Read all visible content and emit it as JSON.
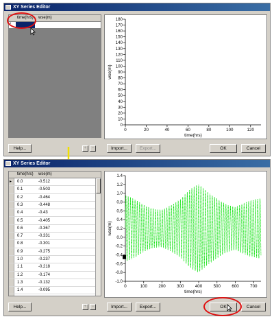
{
  "top": {
    "title": "XY Series Editor",
    "columns": [
      "time(hrs)",
      "wse(m)"
    ],
    "buttons": {
      "help": "Help...",
      "import": "Import...",
      "export": "Export...",
      "ok": "OK",
      "cancel": "Cancel"
    },
    "chart": {
      "ylabel": "wse(m)",
      "xlabel": "time(hrs)",
      "yticks": [
        "0",
        "10",
        "20",
        "30",
        "40",
        "50",
        "60",
        "70",
        "80",
        "90",
        "100",
        "110",
        "120",
        "130",
        "140",
        "150",
        "160",
        "170",
        "180"
      ],
      "xticks": [
        "0",
        "20",
        "40",
        "60",
        "80",
        "100",
        "120"
      ]
    }
  },
  "bottom": {
    "title": "XY Series Editor",
    "columns": [
      "time(hrs)",
      "wse(m)"
    ],
    "rows": [
      [
        "0.0",
        "-0.512"
      ],
      [
        "0.1",
        "-0.503"
      ],
      [
        "0.2",
        "-0.464"
      ],
      [
        "0.3",
        "-0.448"
      ],
      [
        "0.4",
        "-0.43"
      ],
      [
        "0.5",
        "-0.405"
      ],
      [
        "0.6",
        "-0.367"
      ],
      [
        "0.7",
        "-0.331"
      ],
      [
        "0.8",
        "-0.301"
      ],
      [
        "0.9",
        "-0.275"
      ],
      [
        "1.0",
        "-0.237"
      ],
      [
        "1.1",
        "-0.218"
      ],
      [
        "1.2",
        "-0.174"
      ],
      [
        "1.3",
        "-0.132"
      ],
      [
        "1.4",
        "-0.095"
      ]
    ],
    "buttons": {
      "help": "Help...",
      "import": "Import...",
      "export": "Export...",
      "ok": "OK",
      "cancel": "Cancel"
    },
    "chart": {
      "ylabel": "wse(m)",
      "xlabel": "time(hrs)",
      "yticks": [
        "-1.0",
        "-0.8",
        "-0.6",
        "-0.4",
        "-0.2",
        "0.0",
        "0.2",
        "0.4",
        "0.6",
        "0.8",
        "1.0",
        "1.2",
        "1.4"
      ],
      "xticks": [
        "0",
        "100",
        "200",
        "300",
        "400",
        "500",
        "600",
        "700"
      ]
    }
  },
  "chart_data": [
    {
      "type": "line",
      "x": [
        0,
        130
      ],
      "y": [
        0,
        180
      ],
      "series": [
        {
          "values": []
        }
      ],
      "xlabel": "time(hrs)",
      "ylabel": "wse(m)",
      "xlim": [
        0,
        130
      ],
      "ylim": [
        0,
        180
      ]
    },
    {
      "type": "line",
      "xlabel": "time(hrs)",
      "ylabel": "wse(m)",
      "xlim": [
        0,
        740
      ],
      "ylim": [
        -1.0,
        1.4
      ],
      "series": [
        {
          "color": "#00e000",
          "amplitude_envelope": [
            [
              0,
              0.75
            ],
            [
              100,
              0.65
            ],
            [
              200,
              0.6
            ],
            [
              300,
              0.7
            ],
            [
              400,
              1.05
            ],
            [
              500,
              0.95
            ],
            [
              600,
              0.6
            ],
            [
              700,
              0.65
            ],
            [
              740,
              0.7
            ]
          ],
          "mean": 0.2
        }
      ]
    }
  ],
  "colors": {
    "title_bar": "#0a246a",
    "face": "#d4d0c8",
    "series": "#00e000",
    "highlight": "#e01010",
    "arrow": "#f0e000"
  }
}
